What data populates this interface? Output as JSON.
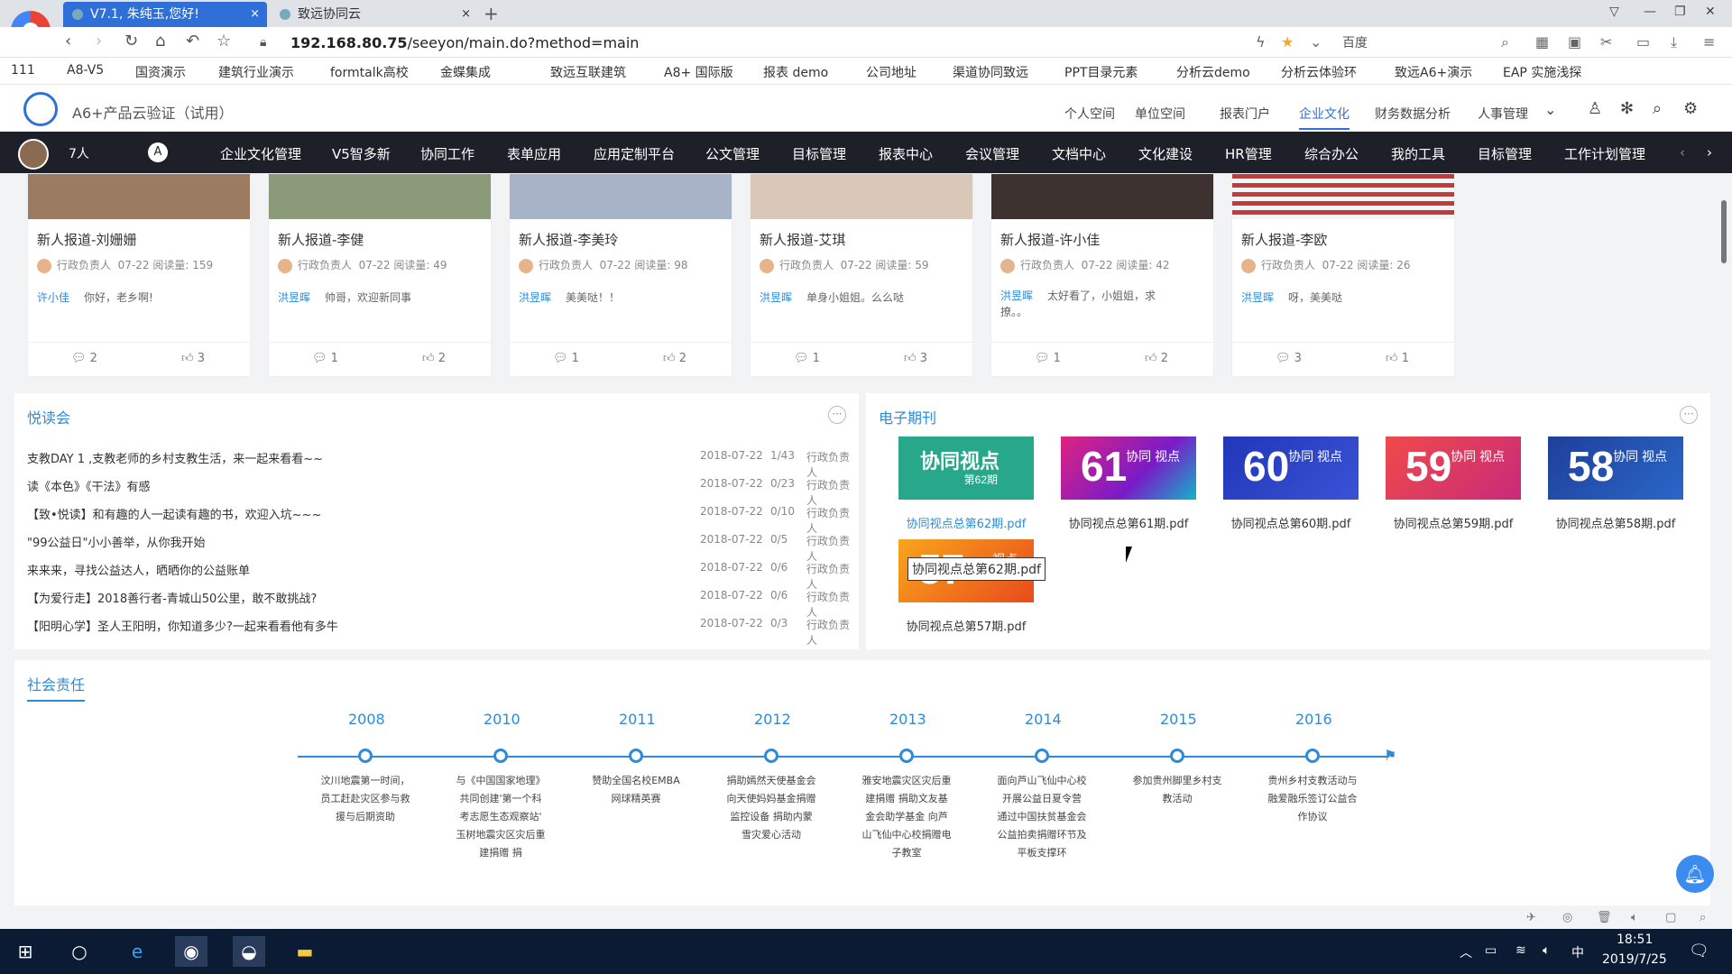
{
  "browser": {
    "tabs": [
      {
        "label": "V7.1, 朱纯玉,您好!",
        "close": "×"
      },
      {
        "label": "致远协同云",
        "close": "×"
      }
    ],
    "new_tab": "+",
    "url_host": "192.168.80.75",
    "url_path": "/seeyon/main.do?method=main",
    "search_engine": "百度",
    "bookmarks": [
      "111",
      "A8-V5",
      "国资演示",
      "建筑行业演示",
      "formtalk高校",
      "金蝶集成",
      "致远互联建筑",
      "A8+ 国际版",
      "报表 demo",
      "公司地址",
      "渠道协同致远",
      "PPT目录元素",
      "分析云demo",
      "分析云体验环",
      "致远A6+演示",
      "EAP 实施浅探"
    ]
  },
  "app": {
    "title": "A6+产品云验证（试用）",
    "top_nav": [
      "个人空间",
      "单位空间",
      "报表门户",
      "企业文化",
      "财务数据分析",
      "人事管理"
    ],
    "top_nav_active": "企业文化",
    "people_count": "7人",
    "main_nav": [
      "企业文化管理",
      "V5智多新",
      "协同工作",
      "表单应用",
      "应用定制平台",
      "公文管理",
      "目标管理",
      "报表中心",
      "会议管理",
      "文档中心",
      "文化建设",
      "HR管理",
      "综合办公",
      "我的工具",
      "目标管理",
      "工作计划管理"
    ]
  },
  "news": [
    {
      "title": "新人报道-刘姗姗",
      "author": "行政负责人",
      "date": "07-22",
      "reads_label": "阅读量:",
      "reads": "159",
      "commenter": "许小佳",
      "comment": "你好，老乡啊!",
      "comments": "2",
      "likes": "3"
    },
    {
      "title": "新人报道-李健",
      "author": "行政负责人",
      "date": "07-22",
      "reads_label": "阅读量:",
      "reads": "49",
      "commenter": "洪昱晖",
      "comment": "帅哥，欢迎新同事",
      "comments": "1",
      "likes": "2"
    },
    {
      "title": "新人报道-李美玲",
      "author": "行政负责人",
      "date": "07-22",
      "reads_label": "阅读量:",
      "reads": "98",
      "commenter": "洪昱晖",
      "comment": "美美哒！！",
      "comments": "1",
      "likes": "2"
    },
    {
      "title": "新人报道-艾琪",
      "author": "行政负责人",
      "date": "07-22",
      "reads_label": "阅读量:",
      "reads": "59",
      "commenter": "洪昱晖",
      "comment": "单身小姐姐。么么哒",
      "comments": "1",
      "likes": "3"
    },
    {
      "title": "新人报道-许小佳",
      "author": "行政负责人",
      "date": "07-22",
      "reads_label": "阅读量:",
      "reads": "42",
      "commenter": "洪昱晖",
      "comment": "太好看了，小姐姐，求撩。。",
      "comments": "1",
      "likes": "2"
    },
    {
      "title": "新人报道-李欧",
      "author": "行政负责人",
      "date": "07-22",
      "reads_label": "阅读量:",
      "reads": "26",
      "commenter": "洪昱晖",
      "comment": "呀，美美哒",
      "comments": "3",
      "likes": "1"
    }
  ],
  "reading": {
    "title": "悦读会",
    "more": "···",
    "rows": [
      {
        "title": "支教DAY 1 ,支教老师的乡村支教生活，来一起来看看~~",
        "date": "2018-07-22",
        "ratio": "1/43",
        "author": "行政负责人"
      },
      {
        "title": "读《本色》《干法》有感",
        "date": "2018-07-22",
        "ratio": "0/23",
        "author": "行政负责人"
      },
      {
        "title": "【致•悦读】和有趣的人一起读有趣的书，欢迎入坑~~~",
        "date": "2018-07-22",
        "ratio": "0/10",
        "author": "行政负责人"
      },
      {
        "title": "\"99公益日\"小小善举，从你我开始",
        "date": "2018-07-22",
        "ratio": "0/5",
        "author": "行政负责人"
      },
      {
        "title": "来来来，寻找公益达人，晒晒你的公益账单",
        "date": "2018-07-22",
        "ratio": "0/6",
        "author": "行政负责人"
      },
      {
        "title": "【为爱行走】2018善行者-青城山50公里，敢不敢挑战?",
        "date": "2018-07-22",
        "ratio": "0/6",
        "author": "行政负责人"
      },
      {
        "title": "【阳明心学】圣人王阳明，你知道多少?一起来看看他有多牛",
        "date": "2018-07-22",
        "ratio": "0/3",
        "author": "行政负责人"
      }
    ]
  },
  "magazine": {
    "title": "电子期刊",
    "more": "···",
    "items": [
      {
        "cover": "协同视点",
        "sub": "第62期",
        "caption": "协同视点总第62期.pdf",
        "color": "#27a88a"
      },
      {
        "cover": "61",
        "sub": "协同 视点",
        "caption": "协同视点总第61期.pdf",
        "color": "#c0197a"
      },
      {
        "cover": "60",
        "sub": "协同 视点",
        "caption": "协同视点总第60期.pdf",
        "color": "#2f44c8"
      },
      {
        "cover": "59",
        "sub": "协同 视点",
        "caption": "协同视点总第59期.pdf",
        "color": "#e0385e"
      },
      {
        "cover": "58",
        "sub": "协同 视点",
        "caption": "协同视点总第58期.pdf",
        "color": "#1f4fa8"
      },
      {
        "cover": "57",
        "sub": "视点",
        "caption": "协同视点总第57期.pdf",
        "color": "#f08a1c"
      }
    ],
    "tooltip": "协同视点总第62期.pdf"
  },
  "social": {
    "title": "社会责任",
    "timeline": [
      {
        "year": "2008",
        "text": "汶川地震第一时间，员工赶赴灾区参与救援与后期资助"
      },
      {
        "year": "2010",
        "text": "与《中国国家地理》共同创建'第一个科考志愿生态观察站' 玉树地震灾区灾后重建捐赠 捐"
      },
      {
        "year": "2011",
        "text": "赞助全国名校EMBA网球精英赛"
      },
      {
        "year": "2012",
        "text": "捐助嫣然天使基金会 向天使妈妈基金捐赠监控设备 捐助内蒙雪灾爱心活动"
      },
      {
        "year": "2013",
        "text": "雅安地震灾区灾后重建捐赠 捐助文友基金会助学基金 向芦山飞仙中心校捐赠电子教室"
      },
      {
        "year": "2014",
        "text": "面向芦山飞仙中心校开展公益日夏令营 通过中国扶贫基金会公益拍卖捐赠环节及平板支撑环"
      },
      {
        "year": "2015",
        "text": "参加贵州脚里乡村支教活动"
      },
      {
        "year": "2016",
        "text": "贵州乡村支教活动与融爱融乐签订公益合作协议"
      }
    ]
  },
  "taskbar": {
    "time": "18:51",
    "date": "2019/7/25",
    "ime": "中"
  }
}
